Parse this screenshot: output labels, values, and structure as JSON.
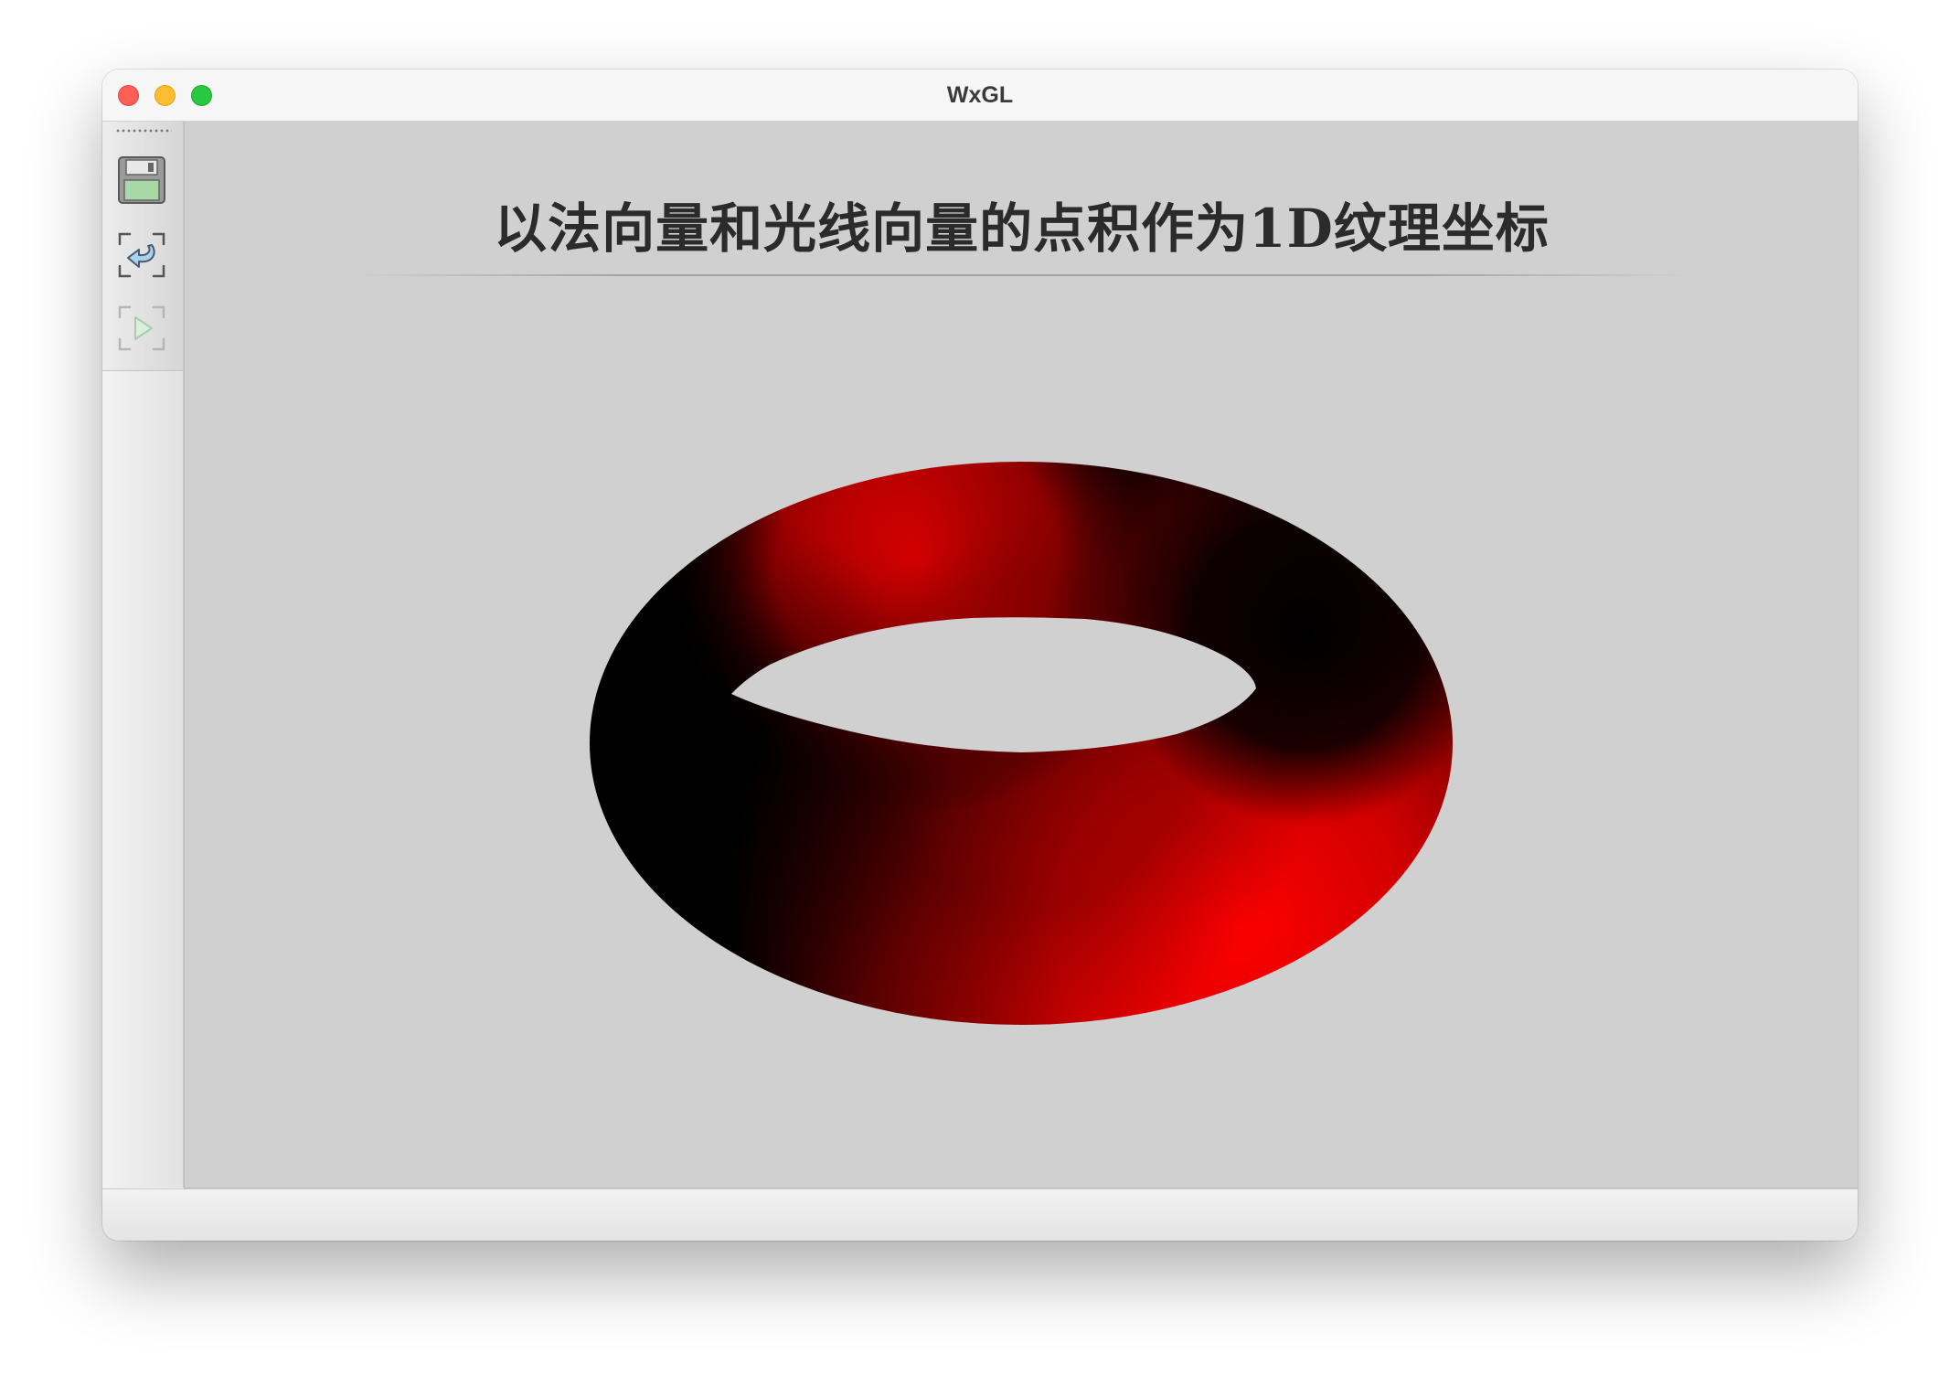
{
  "window": {
    "title": "WxGL"
  },
  "toolbar": {
    "buttons": [
      {
        "name": "save",
        "icon": "save-icon",
        "enabled": true
      },
      {
        "name": "reset-view",
        "icon": "reset-icon",
        "enabled": true
      },
      {
        "name": "play-animation",
        "icon": "play-icon",
        "enabled": false
      }
    ]
  },
  "scene": {
    "title": "以法向量和光线向量的点积作为1D纹理坐标",
    "background_color": "#d0d0d0",
    "model": "torus",
    "texture_colors": [
      "#000000",
      "#ff0000"
    ]
  },
  "colors": {
    "close": "#ff5f57",
    "minimize": "#febc2e",
    "zoom": "#28c840",
    "save_icon_fill": "#a8d8a8"
  }
}
